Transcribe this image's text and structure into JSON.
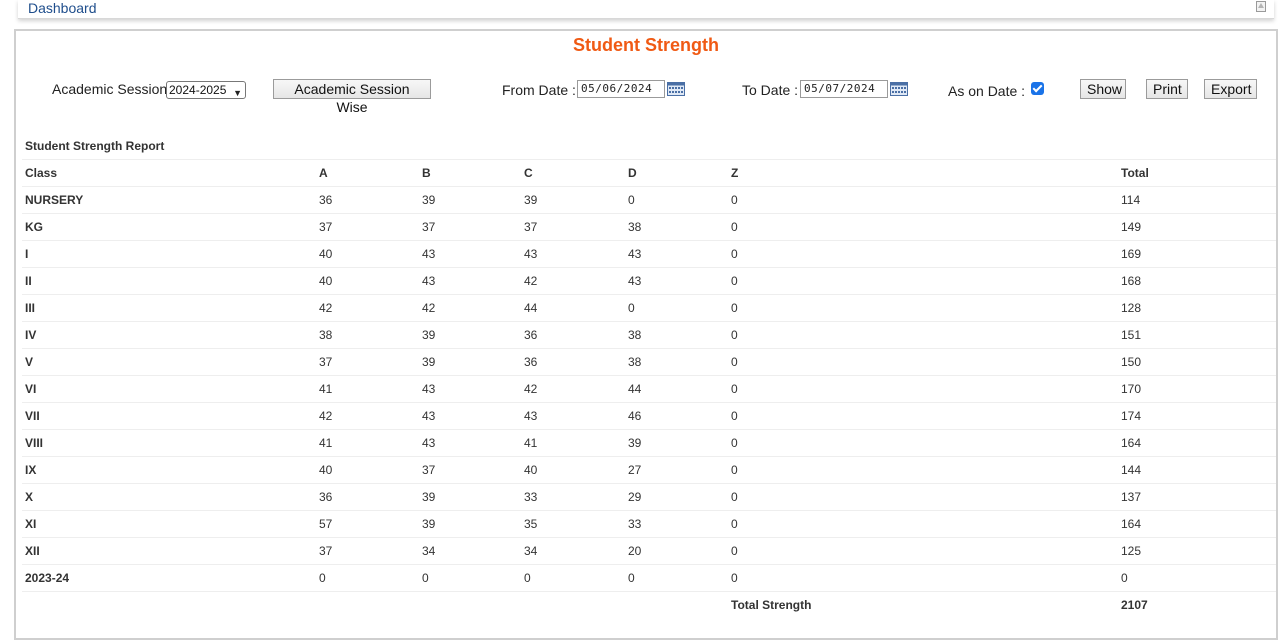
{
  "topbar": {
    "title": "Dashboard"
  },
  "page": {
    "heading": "Student Strength"
  },
  "filters": {
    "session_label": "Academic Session:",
    "session_value": "2024-2025",
    "session_wise_button": "Academic Session Wise",
    "from_label": "From Date :",
    "from_value": "05/06/2024",
    "to_label": "To Date :",
    "to_value": "05/07/2024",
    "as_on_label": "As on Date :",
    "as_on_checked": true,
    "show_button": "Show",
    "print_button": "Print",
    "export_button": "Export"
  },
  "report": {
    "caption": "Student Strength Report",
    "headers": [
      "Class",
      "A",
      "B",
      "C",
      "D",
      "Z",
      "Total"
    ],
    "rows": [
      [
        "NURSERY",
        "36",
        "39",
        "39",
        "0",
        "0",
        "114"
      ],
      [
        "KG",
        "37",
        "37",
        "37",
        "38",
        "0",
        "149"
      ],
      [
        "I",
        "40",
        "43",
        "43",
        "43",
        "0",
        "169"
      ],
      [
        "II",
        "40",
        "43",
        "42",
        "43",
        "0",
        "168"
      ],
      [
        "III",
        "42",
        "42",
        "44",
        "0",
        "0",
        "128"
      ],
      [
        "IV",
        "38",
        "39",
        "36",
        "38",
        "0",
        "151"
      ],
      [
        "V",
        "37",
        "39",
        "36",
        "38",
        "0",
        "150"
      ],
      [
        "VI",
        "41",
        "43",
        "42",
        "44",
        "0",
        "170"
      ],
      [
        "VII",
        "42",
        "43",
        "43",
        "46",
        "0",
        "174"
      ],
      [
        "VIII",
        "41",
        "43",
        "41",
        "39",
        "0",
        "164"
      ],
      [
        "IX",
        "40",
        "37",
        "40",
        "27",
        "0",
        "144"
      ],
      [
        "X",
        "36",
        "39",
        "33",
        "29",
        "0",
        "137"
      ],
      [
        "XI",
        "57",
        "39",
        "35",
        "33",
        "0",
        "164"
      ],
      [
        "XII",
        "37",
        "34",
        "34",
        "20",
        "0",
        "125"
      ],
      [
        "2023-24",
        "0",
        "0",
        "0",
        "0",
        "0",
        "0"
      ]
    ],
    "total_label": "Total Strength",
    "total_value": "2107"
  },
  "colors": {
    "heading": "#f05a14",
    "link": "#1f4e8c",
    "checkbox": "#1a73e8"
  }
}
